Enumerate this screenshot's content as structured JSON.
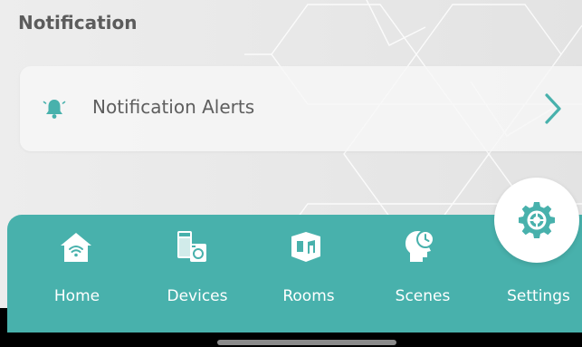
{
  "section": {
    "title": "Notification"
  },
  "notification_row": {
    "label": "Notification Alerts",
    "icon": "bell-icon",
    "chevron": "chevron-right-icon"
  },
  "tabbar": {
    "items": [
      {
        "label": "Home",
        "icon": "home-wifi-icon"
      },
      {
        "label": "Devices",
        "icon": "devices-icon"
      },
      {
        "label": "Rooms",
        "icon": "room-icon"
      },
      {
        "label": "Scenes",
        "icon": "scene-head-icon"
      },
      {
        "label": "Settings",
        "icon": "gear-icon",
        "active": true
      }
    ]
  },
  "colors": {
    "accent": "#48b1ac",
    "background": "#e8e8e8",
    "text": "#5e5e5e",
    "card": "#f6f6f6"
  }
}
